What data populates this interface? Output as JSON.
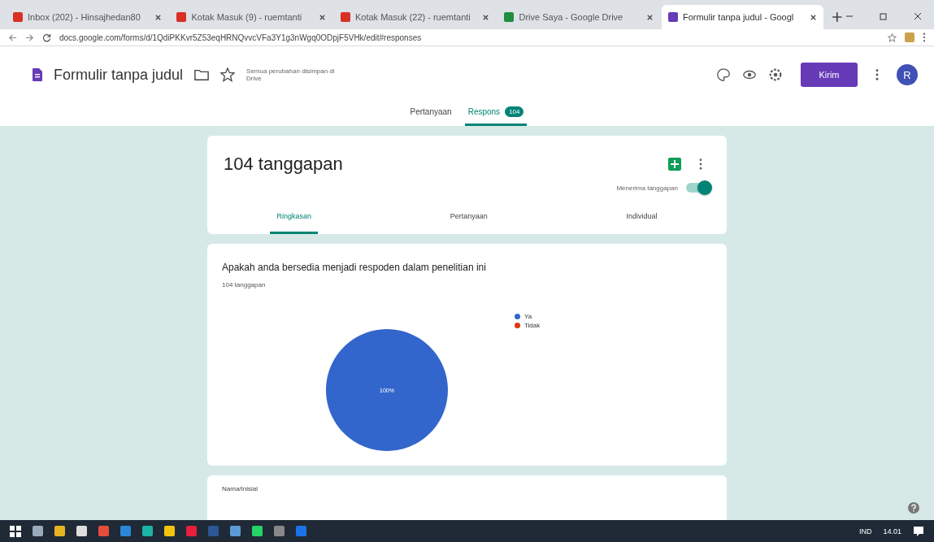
{
  "browser": {
    "tabs": [
      {
        "title": "Inbox (202) - Hinsajhedan80",
        "selected": false
      },
      {
        "title": "Kotak Masuk (9) - ruemtanti",
        "selected": false
      },
      {
        "title": "Kotak Masuk (22) - ruemtanti",
        "selected": false
      },
      {
        "title": "Drive Saya - Google Drive",
        "selected": false
      },
      {
        "title": "Formulir tanpa judul - Googl",
        "selected": true
      }
    ],
    "url": "docs.google.com/forms/d/1QdiPKKvr5Z53eqHRNQvvcVFa3Y1g3nWgq0ODpjF5VHk/edit#responses"
  },
  "header": {
    "title": "Formulir tanpa judul",
    "save_status": "Semua perubahan disimpan di Drive",
    "send": "Kirim",
    "avatar": "R",
    "tabs": [
      {
        "label": "Pertanyaan",
        "selected": false
      },
      {
        "label": "Respons",
        "badge": "104",
        "selected": true
      }
    ]
  },
  "summary": {
    "title": "104 tanggapan",
    "accepting_label": "Menerima tanggapan",
    "accepting": true,
    "tabs": [
      {
        "label": "Ringkasan",
        "selected": true
      },
      {
        "label": "Pertanyaan",
        "selected": false
      },
      {
        "label": "Individual",
        "selected": false
      }
    ]
  },
  "question": {
    "title": "Apakah anda bersedia menjadi respoden dalam penelitian ini",
    "count": "104 tanggapan",
    "chart_data": {
      "type": "pie",
      "categories": [
        "Ya",
        "Tidak"
      ],
      "values": [
        100,
        0
      ],
      "value_labels": [
        "100%",
        null
      ]
    }
  },
  "next_question": {
    "title": "Nama/Inisial"
  },
  "taskbar": {
    "language": "IND",
    "time": "14.01"
  }
}
